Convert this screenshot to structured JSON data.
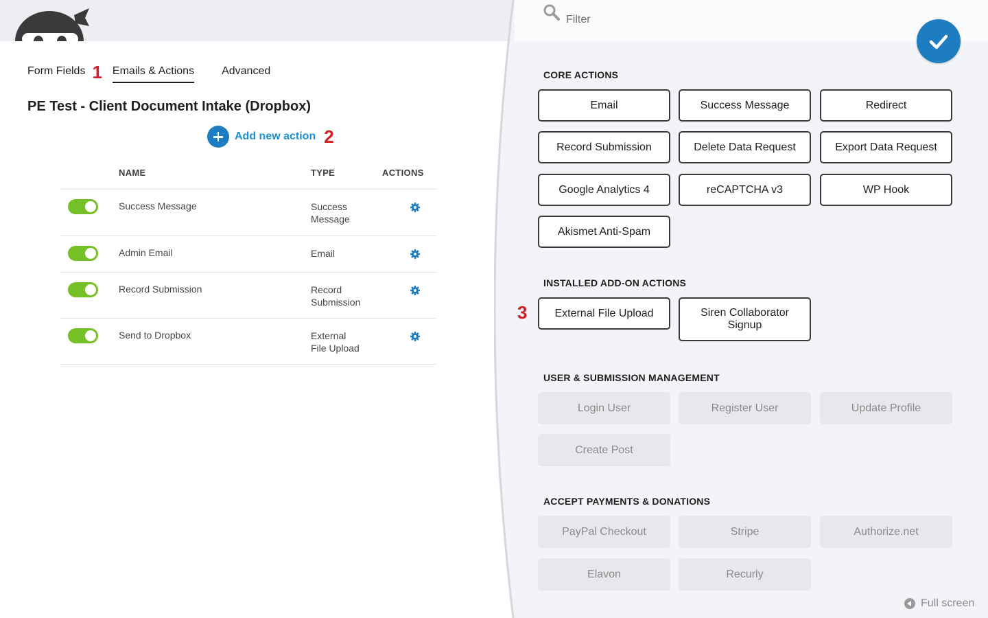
{
  "colors": {
    "accent": "#1d7dc0",
    "link": "#1d8fd4",
    "toggle_on": "#74c026",
    "marker_red": "#d21f26",
    "panel_bg": "#f2f4f8"
  },
  "tabs": [
    {
      "label": "Form Fields",
      "active": false
    },
    {
      "label": "Emails & Actions",
      "active": true
    },
    {
      "label": "Advanced",
      "active": false
    }
  ],
  "markers": {
    "one": "1",
    "two": "2",
    "three": "3"
  },
  "form_title": "PE Test - Client Document Intake (Dropbox)",
  "add_action_label": "Add new action",
  "table": {
    "headers": {
      "name": "NAME",
      "type": "TYPE",
      "actions": "ACTIONS"
    },
    "rows": [
      {
        "name": "Success Message",
        "type_line1": "Success",
        "type_line2": "Message",
        "enabled": true
      },
      {
        "name": "Admin Email",
        "type_line1": "Email",
        "type_line2": "",
        "enabled": true
      },
      {
        "name": "Record Submission",
        "type_line1": "Record",
        "type_line2": "Submission",
        "enabled": true
      },
      {
        "name": "Send to Dropbox",
        "type_line1": "External",
        "type_line2": "File Upload",
        "enabled": true
      }
    ]
  },
  "drawer": {
    "filter_placeholder": "Filter",
    "sections": {
      "core": "CORE ACTIONS",
      "addon": "INSTALLED ADD-ON ACTIONS",
      "user": "USER & SUBMISSION MANAGEMENT",
      "payments": "ACCEPT PAYMENTS & DONATIONS"
    },
    "core_actions": [
      "Email",
      "Success Message",
      "Redirect",
      "Record Submission",
      "Delete Data Request",
      "Export Data Request",
      "Google Analytics 4",
      "reCAPTCHA v3",
      "WP Hook",
      "Akismet Anti-Spam"
    ],
    "addon_actions": [
      "External File Upload",
      "Siren Collaborator Signup"
    ],
    "user_actions": [
      "Login User",
      "Register User",
      "Update Profile",
      "Create Post"
    ],
    "payment_actions": [
      "PayPal Checkout",
      "Stripe",
      "Authorize.net",
      "Elavon",
      "Recurly"
    ],
    "fullscreen_label": "Full screen"
  }
}
